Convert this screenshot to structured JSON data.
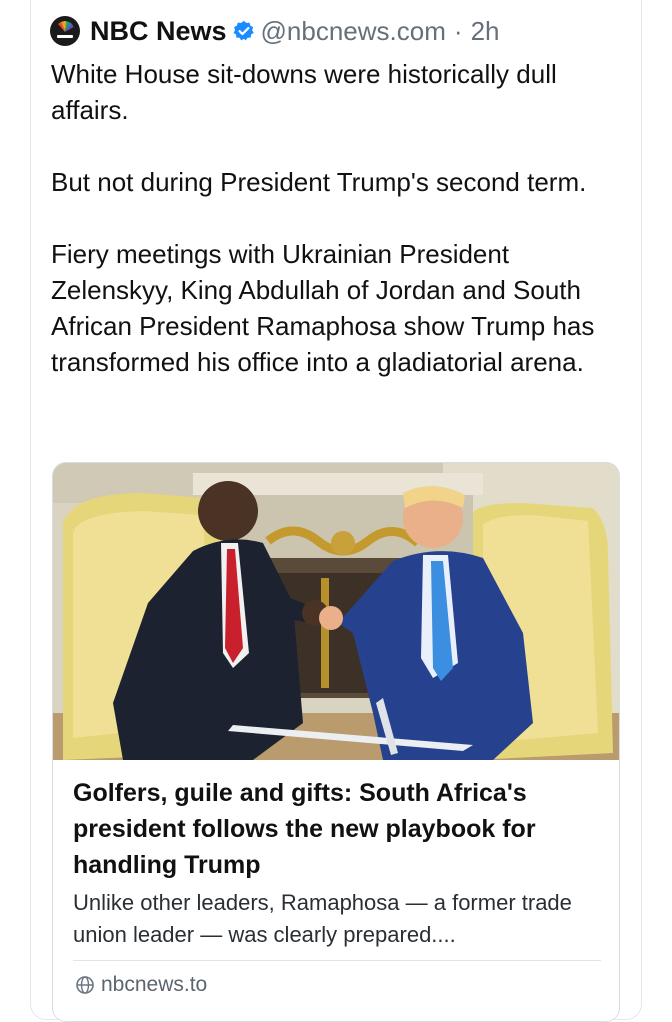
{
  "post": {
    "author": "NBC News",
    "handle": "@nbcnews.com",
    "separator": "·",
    "time": "2h",
    "verified": true,
    "paragraphs": [
      "White House sit-downs were historically dull affairs.",
      "But not during President Trump's second term.",
      "Fiery meetings with Ukrainian President Zelenskyy, King Abdullah of Jordan and South African President Ramaphosa show Trump has transformed his office into a gladiatorial arena."
    ]
  },
  "link_card": {
    "title": "Golfers, guile and gifts: South Africa's president follows the new playbook for handling Trump",
    "description": "Unlike other leaders, Ramaphosa — a former trade union leader  — was clearly prepared....",
    "domain": "nbcnews.to"
  },
  "colors": {
    "verified": "#1a8cff",
    "secondary_text": "#66707b",
    "border": "#d9dde2"
  },
  "icons": {
    "avatar": "nbc-peacock-logo",
    "verified": "verified-check-icon",
    "domain": "globe-icon"
  }
}
